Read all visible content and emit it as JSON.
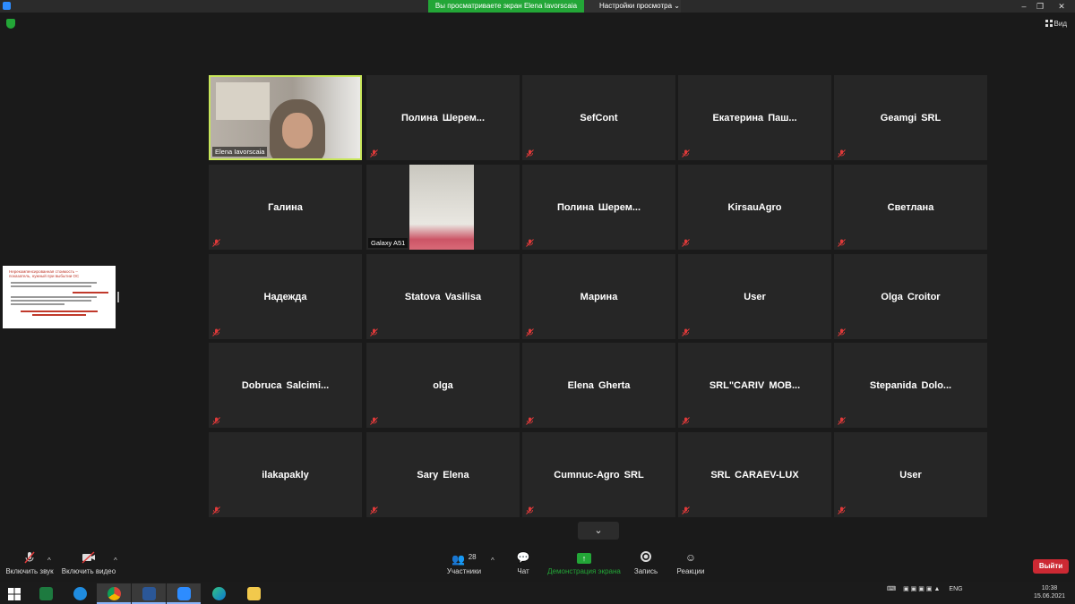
{
  "window": {
    "banner": "Вы просматриваете экран Elena Iavorscaia",
    "view_options": "Настройки просмотра",
    "gallery_label": "Вид"
  },
  "tiles": [
    {
      "name": "Elena Iavorscaia",
      "kind": "speaker"
    },
    {
      "name": "Полина  Шерем..."
    },
    {
      "name": "SefCont"
    },
    {
      "name": "Екатерина  Паш..."
    },
    {
      "name": "Geamgi SRL"
    },
    {
      "name": "Галина"
    },
    {
      "name": "Galaxy A51",
      "kind": "video"
    },
    {
      "name": "Полина  Шерем..."
    },
    {
      "name": "KirsauAgro"
    },
    {
      "name": "Светлана"
    },
    {
      "name": "Надежда"
    },
    {
      "name": "Statova Vasilisa"
    },
    {
      "name": "Марина"
    },
    {
      "name": "User"
    },
    {
      "name": "Olga Croitor"
    },
    {
      "name": "Dobruca  Salcimi..."
    },
    {
      "name": "olga"
    },
    {
      "name": "Elena Gherta"
    },
    {
      "name": "SRL\"CARIV  MOB..."
    },
    {
      "name": "Stepanida  Dolo..."
    },
    {
      "name": "ilakapakly"
    },
    {
      "name": "Sary Elena"
    },
    {
      "name": "Cumnuc-Agro SRL"
    },
    {
      "name": "SRL CARAEV-LUX"
    },
    {
      "name": "User"
    }
  ],
  "thumbnail": {
    "heading": "Нерекомпенсированная стоимость – показатель, нужный при выбытии ОС"
  },
  "toolbar": {
    "audio": "Включить звук",
    "video": "Включить видео",
    "participants": "Участники",
    "participants_count": "28",
    "chat": "Чат",
    "share": "Демонстрация экрана",
    "record": "Запись",
    "reactions": "Реакции",
    "exit": "Выйти"
  },
  "taskbar": {
    "lang": "ENG",
    "time": "10:38",
    "date": "15.06.2021"
  },
  "colors": {
    "banner": "#23a637",
    "speaker_border": "#c8e65a",
    "exit": "#cc2933",
    "share": "#23a637"
  }
}
